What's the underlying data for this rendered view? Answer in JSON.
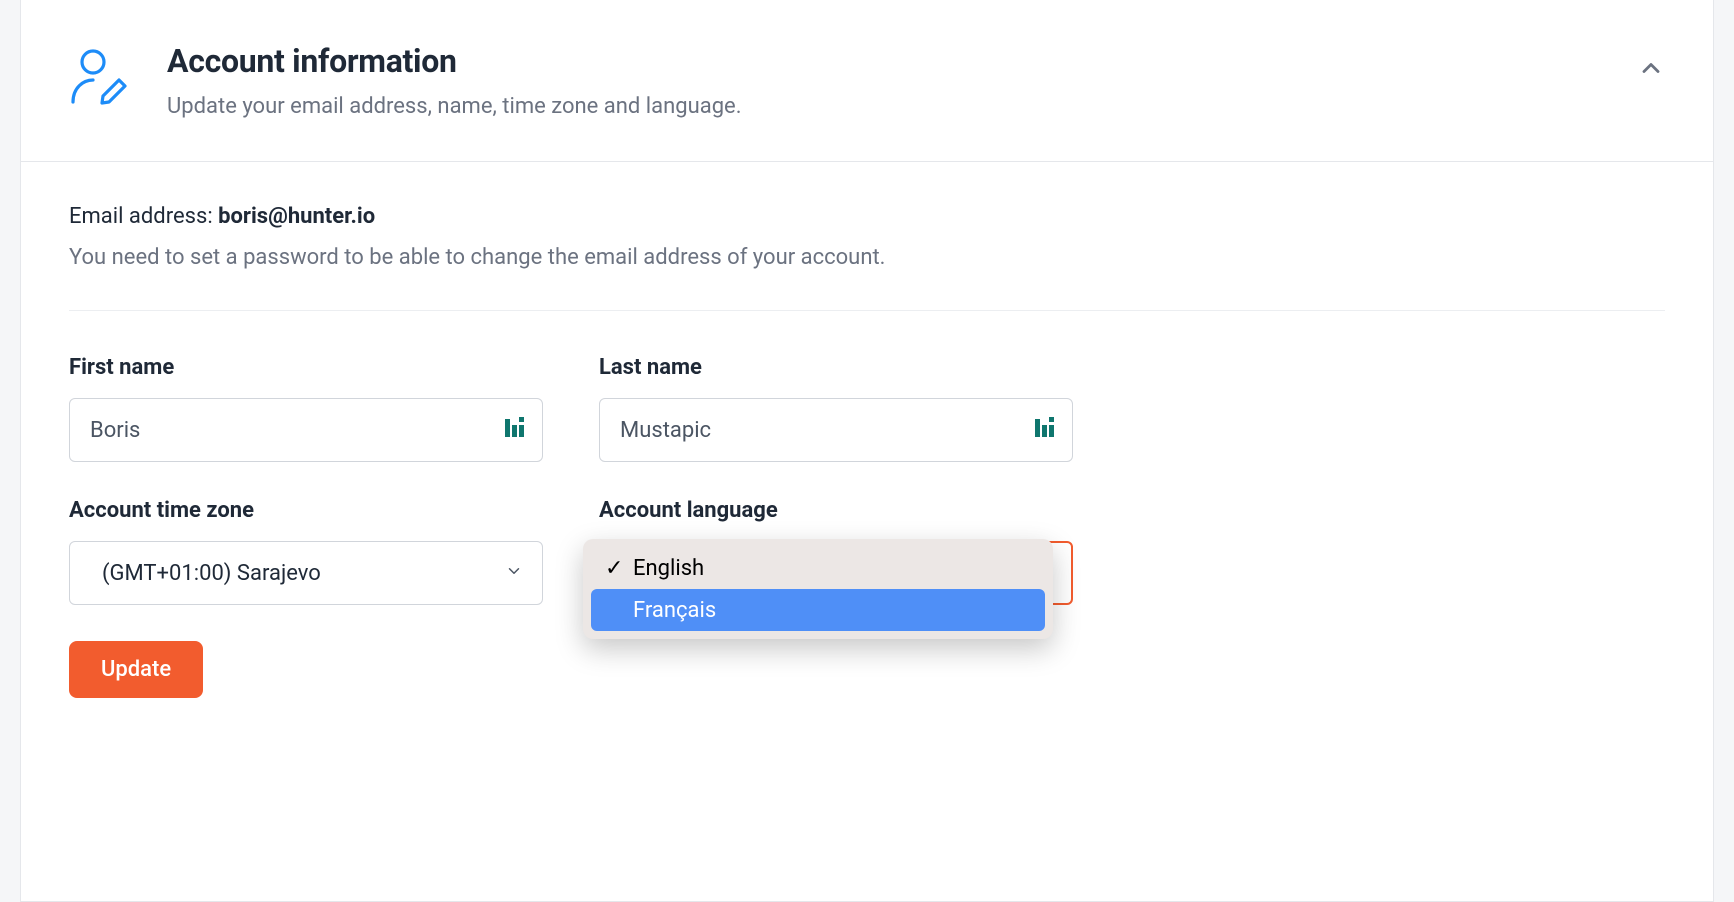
{
  "header": {
    "title": "Account information",
    "subtitle": "Update your email address, name, time zone and language."
  },
  "email": {
    "label": "Email address: ",
    "value": "boris@hunter.io",
    "note": "You need to set a password to be able to change the email address of your account."
  },
  "form": {
    "first_name": {
      "label": "First name",
      "value": "Boris"
    },
    "last_name": {
      "label": "Last name",
      "value": "Mustapic"
    },
    "time_zone": {
      "label": "Account time zone",
      "value": "(GMT+01:00) Sarajevo"
    },
    "language": {
      "label": "Account language",
      "selected": "English",
      "options": [
        {
          "label": "English",
          "selected": true,
          "highlighted": false
        },
        {
          "label": "Français",
          "selected": false,
          "highlighted": true
        }
      ]
    }
  },
  "actions": {
    "update_label": "Update"
  },
  "colors": {
    "accent": "#f25c2e",
    "icon_blue": "#1d8cf8",
    "dropdown_highlight": "#4f8ff7",
    "pwmgr_teal": "#0f766e"
  }
}
